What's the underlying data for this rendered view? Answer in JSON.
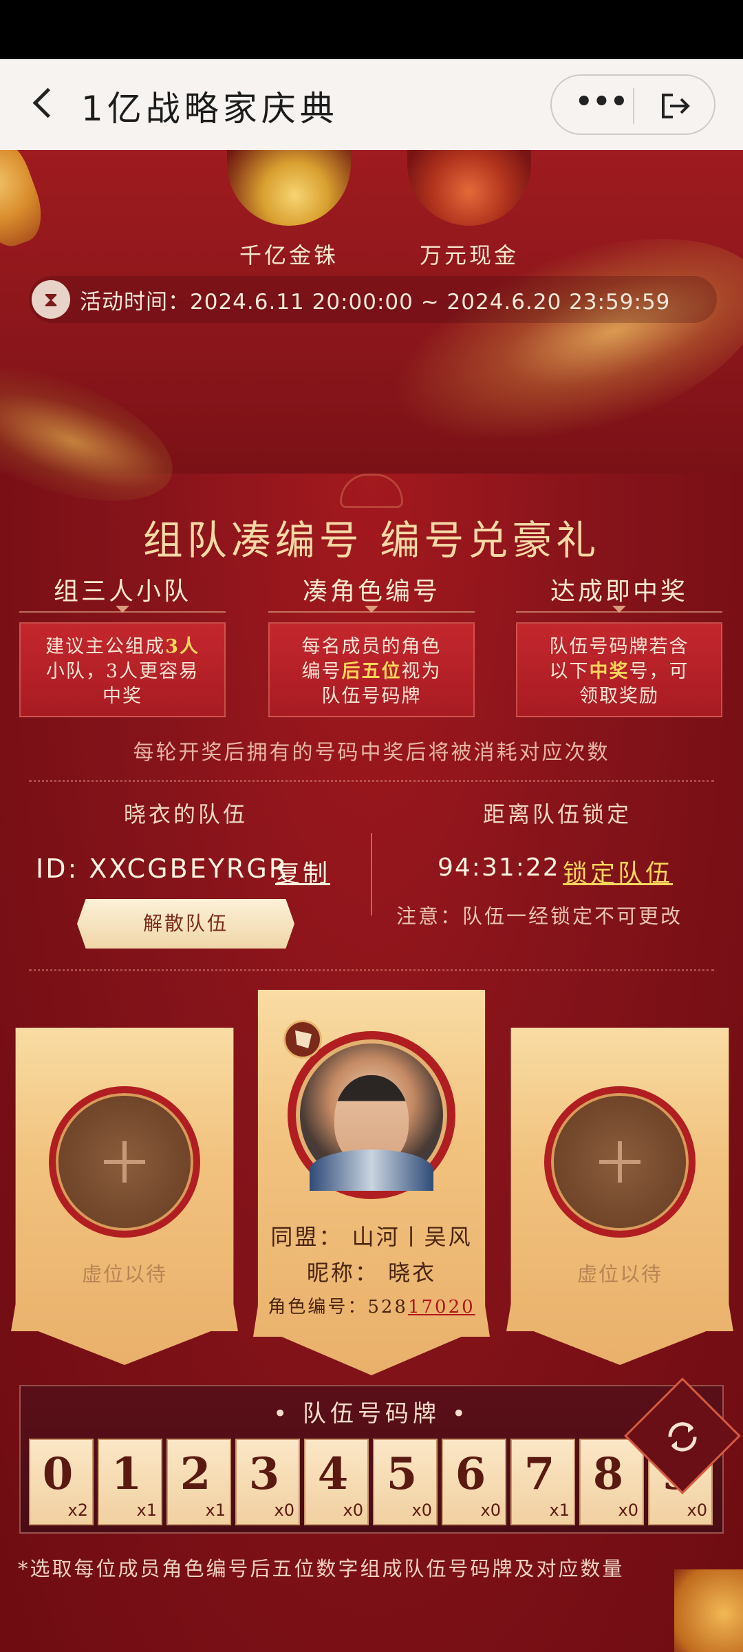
{
  "nav": {
    "title": "1亿战略家庆典",
    "more": "•••"
  },
  "prizes": [
    {
      "label": "千亿金铢"
    },
    {
      "label": "万元现金"
    }
  ],
  "activity_time": "活动时间：2024.6.11  20:00:00 ~ 2024.6.20  23:59:59",
  "section_title": "组队凑编号  编号兑豪礼",
  "steps": [
    {
      "title": "组三人小队",
      "line1_pre": "建议主公组成",
      "line1_hl": "3人",
      "line2": "小队，3人更容易",
      "line3": "中奖"
    },
    {
      "title": "凑角色编号",
      "line1_pre": "每名成员的角色",
      "line1_hl": "",
      "line2_pre": "编号",
      "line2_hl": "后五位",
      "line2_post": "视为",
      "line3": "队伍号码牌"
    },
    {
      "title": "达成即中奖",
      "line1_pre": "队伍号码牌若含",
      "line1_hl": "",
      "line2_pre": "以下",
      "line2_hl": "中奖",
      "line2_post": "号，可",
      "line3": "领取奖励"
    }
  ],
  "round_note": "每轮开奖后拥有的号码中奖后将被消耗对应次数",
  "team": {
    "name": "晓衣的队伍",
    "id": "ID: XXCGBEYRGR",
    "copy": "复制",
    "disband": "解散队伍",
    "lock_title": "距离队伍锁定",
    "countdown": "94:31:22",
    "lock_action": "锁定队伍",
    "lock_note": "注意：队伍一经锁定不可更改"
  },
  "slots": {
    "empty_label": "虚位以待",
    "member": {
      "alliance": "同盟：  山河丨吴风",
      "nickname": "昵称：  晓衣",
      "code_label": "角色编号：",
      "code_prefix": "528",
      "code_suffix": "17020"
    }
  },
  "plate": {
    "title": "• 队伍号码牌 •",
    "digits": [
      {
        "num": "0",
        "count": "x2"
      },
      {
        "num": "1",
        "count": "x1"
      },
      {
        "num": "2",
        "count": "x1"
      },
      {
        "num": "3",
        "count": "x0"
      },
      {
        "num": "4",
        "count": "x0"
      },
      {
        "num": "5",
        "count": "x0"
      },
      {
        "num": "6",
        "count": "x0"
      },
      {
        "num": "7",
        "count": "x1"
      },
      {
        "num": "8",
        "count": "x0"
      },
      {
        "num": "9",
        "count": "x0"
      }
    ]
  },
  "footnote": "*选取每位成员角色编号后五位数字组成队伍号码牌及对应数量",
  "colors": {
    "primary_red": "#a3191e",
    "gold": "#f6d9a6",
    "highlight": "#ffd65a"
  }
}
